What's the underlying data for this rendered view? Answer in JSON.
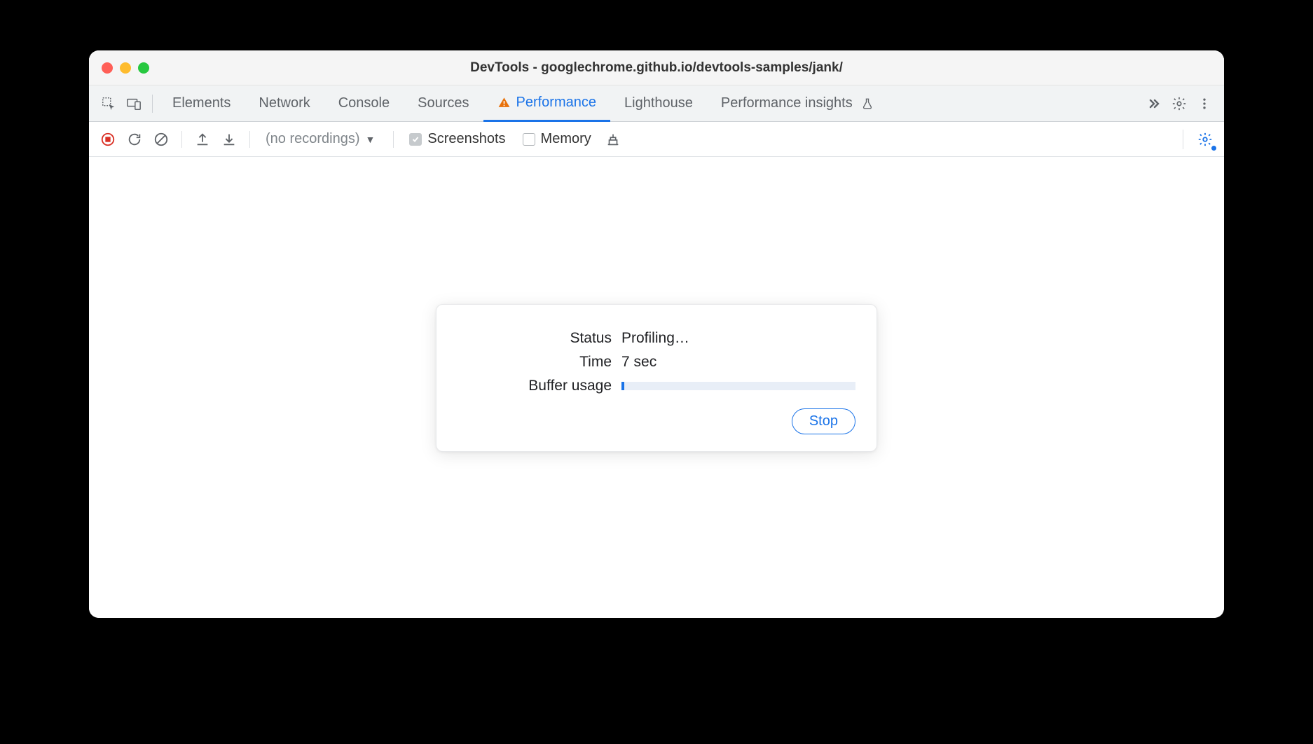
{
  "titlebar": {
    "title": "DevTools - googlechrome.github.io/devtools-samples/jank/"
  },
  "tabs": {
    "elements": "Elements",
    "network": "Network",
    "console": "Console",
    "sources": "Sources",
    "performance": "Performance",
    "lighthouse": "Lighthouse",
    "perf_insights": "Performance insights"
  },
  "toolbar": {
    "recordings_label": "(no recordings)",
    "screenshots_label": "Screenshots",
    "memory_label": "Memory"
  },
  "dialog": {
    "status_label": "Status",
    "status_value": "Profiling…",
    "time_label": "Time",
    "time_value": "7 sec",
    "buffer_label": "Buffer usage",
    "stop_label": "Stop"
  }
}
